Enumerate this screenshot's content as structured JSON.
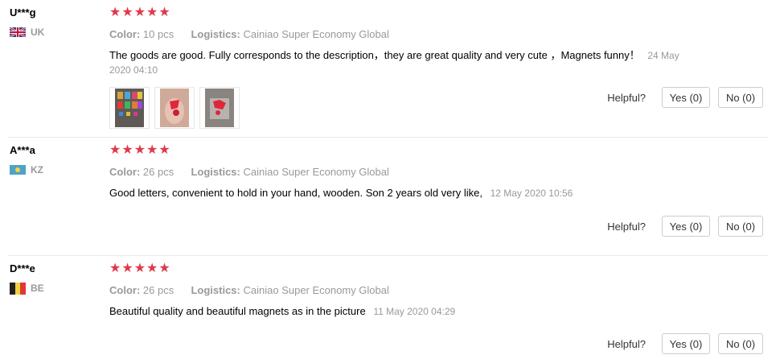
{
  "reviews": [
    {
      "user": "U***g",
      "country_code": "UK",
      "flag_icon": "uk-flag-icon",
      "stars": "★★★★★",
      "rating": 5,
      "color_label": "Color:",
      "color_value": "10 pcs",
      "logistics_label": "Logistics:",
      "logistics_value": "Cainiao Super Economy Global",
      "text": "The goods are good. Fully corresponds to the description，they are great quality and very cute ，Magnets funny！",
      "date": "24 May 2020 04:10",
      "has_photos": true,
      "helpful_label": "Helpful?",
      "yes_label": "Yes (0)",
      "no_label": "No (0)"
    },
    {
      "user": "A***a",
      "country_code": "KZ",
      "flag_icon": "kz-flag-icon",
      "stars": "★★★★★",
      "rating": 5,
      "color_label": "Color:",
      "color_value": "26 pcs",
      "logistics_label": "Logistics:",
      "logistics_value": "Cainiao Super Economy Global",
      "text": "Good letters, convenient to hold in your hand, wooden. Son 2 years old very like,",
      "date": "12 May 2020 10:56",
      "has_photos": false,
      "helpful_label": "Helpful?",
      "yes_label": "Yes (0)",
      "no_label": "No (0)"
    },
    {
      "user": "D***e",
      "country_code": "BE",
      "flag_icon": "be-flag-icon",
      "stars": "★★★★★",
      "rating": 5,
      "color_label": "Color:",
      "color_value": "26 pcs",
      "logistics_label": "Logistics:",
      "logistics_value": "Cainiao Super Economy Global",
      "text": "Beautiful quality and beautiful magnets as in the picture",
      "date": "11 May 2020 04:29",
      "has_photos": false,
      "helpful_label": "Helpful?",
      "yes_label": "Yes (0)",
      "no_label": "No (0)"
    }
  ],
  "colors": {
    "star": "#e0394b",
    "muted": "#999999",
    "text": "#000000"
  }
}
